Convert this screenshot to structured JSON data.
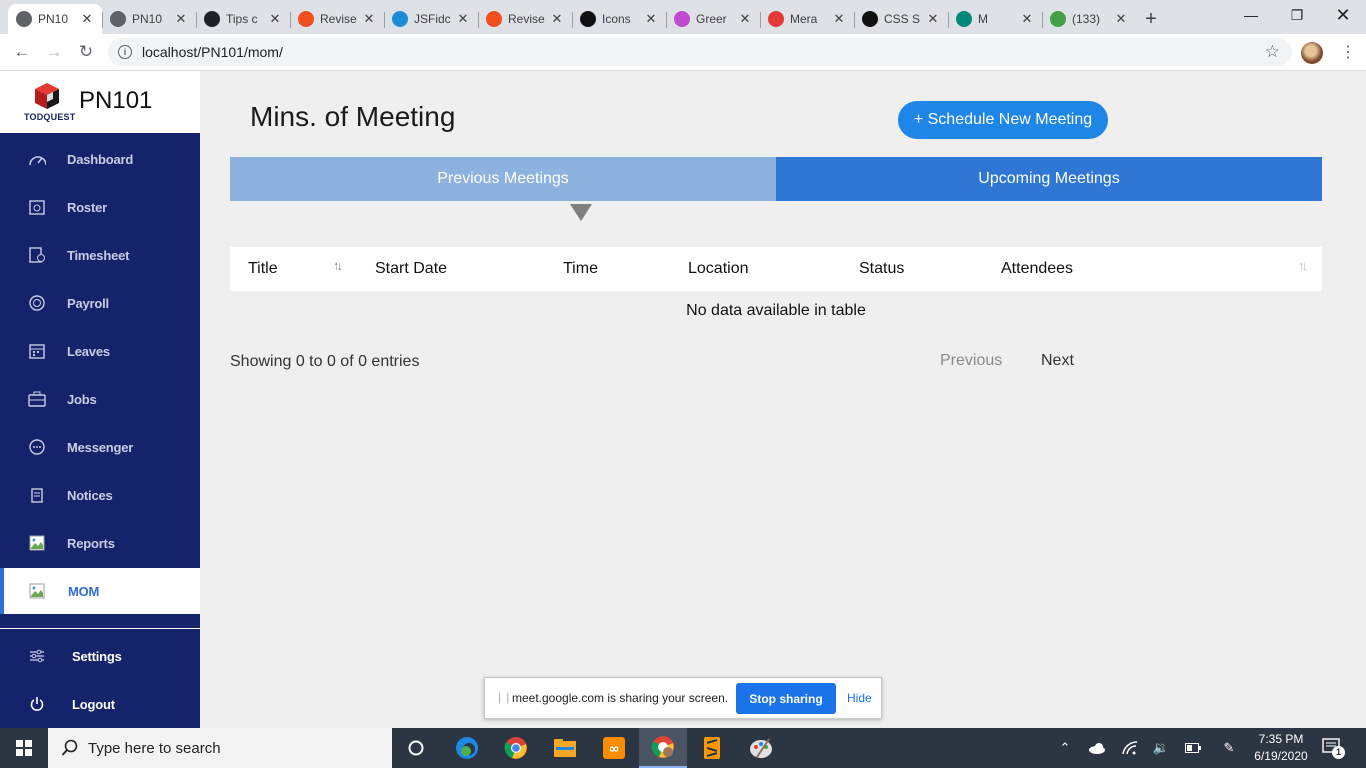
{
  "browser": {
    "tabs": [
      {
        "label": "PN10",
        "active": true,
        "fav_color": "#5f6368"
      },
      {
        "label": "PN10",
        "active": false,
        "fav_color": "#5f6368"
      },
      {
        "label": "Tips c",
        "active": false,
        "fav_color": "#202124"
      },
      {
        "label": "Revise",
        "active": false,
        "fav_color": "#f24e1e"
      },
      {
        "label": "JSFidc",
        "active": false,
        "fav_color": "#1a8cd8"
      },
      {
        "label": "Revise",
        "active": false,
        "fav_color": "#f24e1e"
      },
      {
        "label": "Icons",
        "active": false,
        "fav_color": "#111111"
      },
      {
        "label": "Greer",
        "active": false,
        "fav_color": "#c04ad0"
      },
      {
        "label": "Mera",
        "active": false,
        "fav_color": "#e53935"
      },
      {
        "label": "CSS S",
        "active": false,
        "fav_color": "#111111"
      },
      {
        "label": "M",
        "active": false,
        "fav_color": "#00897b"
      },
      {
        "label": "(133)",
        "active": false,
        "fav_color": "#43a047"
      }
    ],
    "url": "localhost/PN101/mom/"
  },
  "sidebar": {
    "brand_name": "PN101",
    "logo_text": "TODQUEST",
    "items": [
      {
        "label": "Dashboard",
        "icon": "dashboard-icon"
      },
      {
        "label": "Roster",
        "icon": "roster-icon"
      },
      {
        "label": "Timesheet",
        "icon": "timesheet-icon"
      },
      {
        "label": "Payroll",
        "icon": "payroll-icon"
      },
      {
        "label": "Leaves",
        "icon": "calendar-icon"
      },
      {
        "label": "Jobs",
        "icon": "briefcase-icon"
      },
      {
        "label": "Messenger",
        "icon": "chat-icon"
      },
      {
        "label": "Notices",
        "icon": "notice-icon"
      },
      {
        "label": "Reports",
        "icon": "broken-image-icon"
      },
      {
        "label": "MOM",
        "icon": "broken-image-icon",
        "active": true
      }
    ],
    "bottom_items": [
      {
        "label": "Settings",
        "icon": "sliders-icon"
      },
      {
        "label": "Logout",
        "icon": "power-icon"
      }
    ]
  },
  "main": {
    "title": "Mins. of Meeting",
    "schedule_button": "+ Schedule New Meeting",
    "tabs": [
      {
        "label": "Previous Meetings",
        "selected": true
      },
      {
        "label": "Upcoming Meetings",
        "selected": false
      }
    ],
    "table": {
      "columns": [
        "Title",
        "Start Date",
        "Time",
        "Location",
        "Status",
        "Attendees"
      ],
      "empty_message": "No data available in table",
      "info": "Showing 0 to 0 of 0 entries",
      "previous": "Previous",
      "next": "Next"
    }
  },
  "share_bar": {
    "message": "meet.google.com is sharing your screen.",
    "stop_button": "Stop sharing",
    "hide": "Hide"
  },
  "taskbar": {
    "search_placeholder": "Type here to search",
    "time": "7:35 PM",
    "date": "6/19/2020",
    "notification_count": "1"
  },
  "colors": {
    "sidebar_bg": "#14236a",
    "accent": "#2d6fd6",
    "tab_previous": "#8db2e0",
    "tab_upcoming": "#2e77d4",
    "schedule_button": "#1e86e6"
  }
}
